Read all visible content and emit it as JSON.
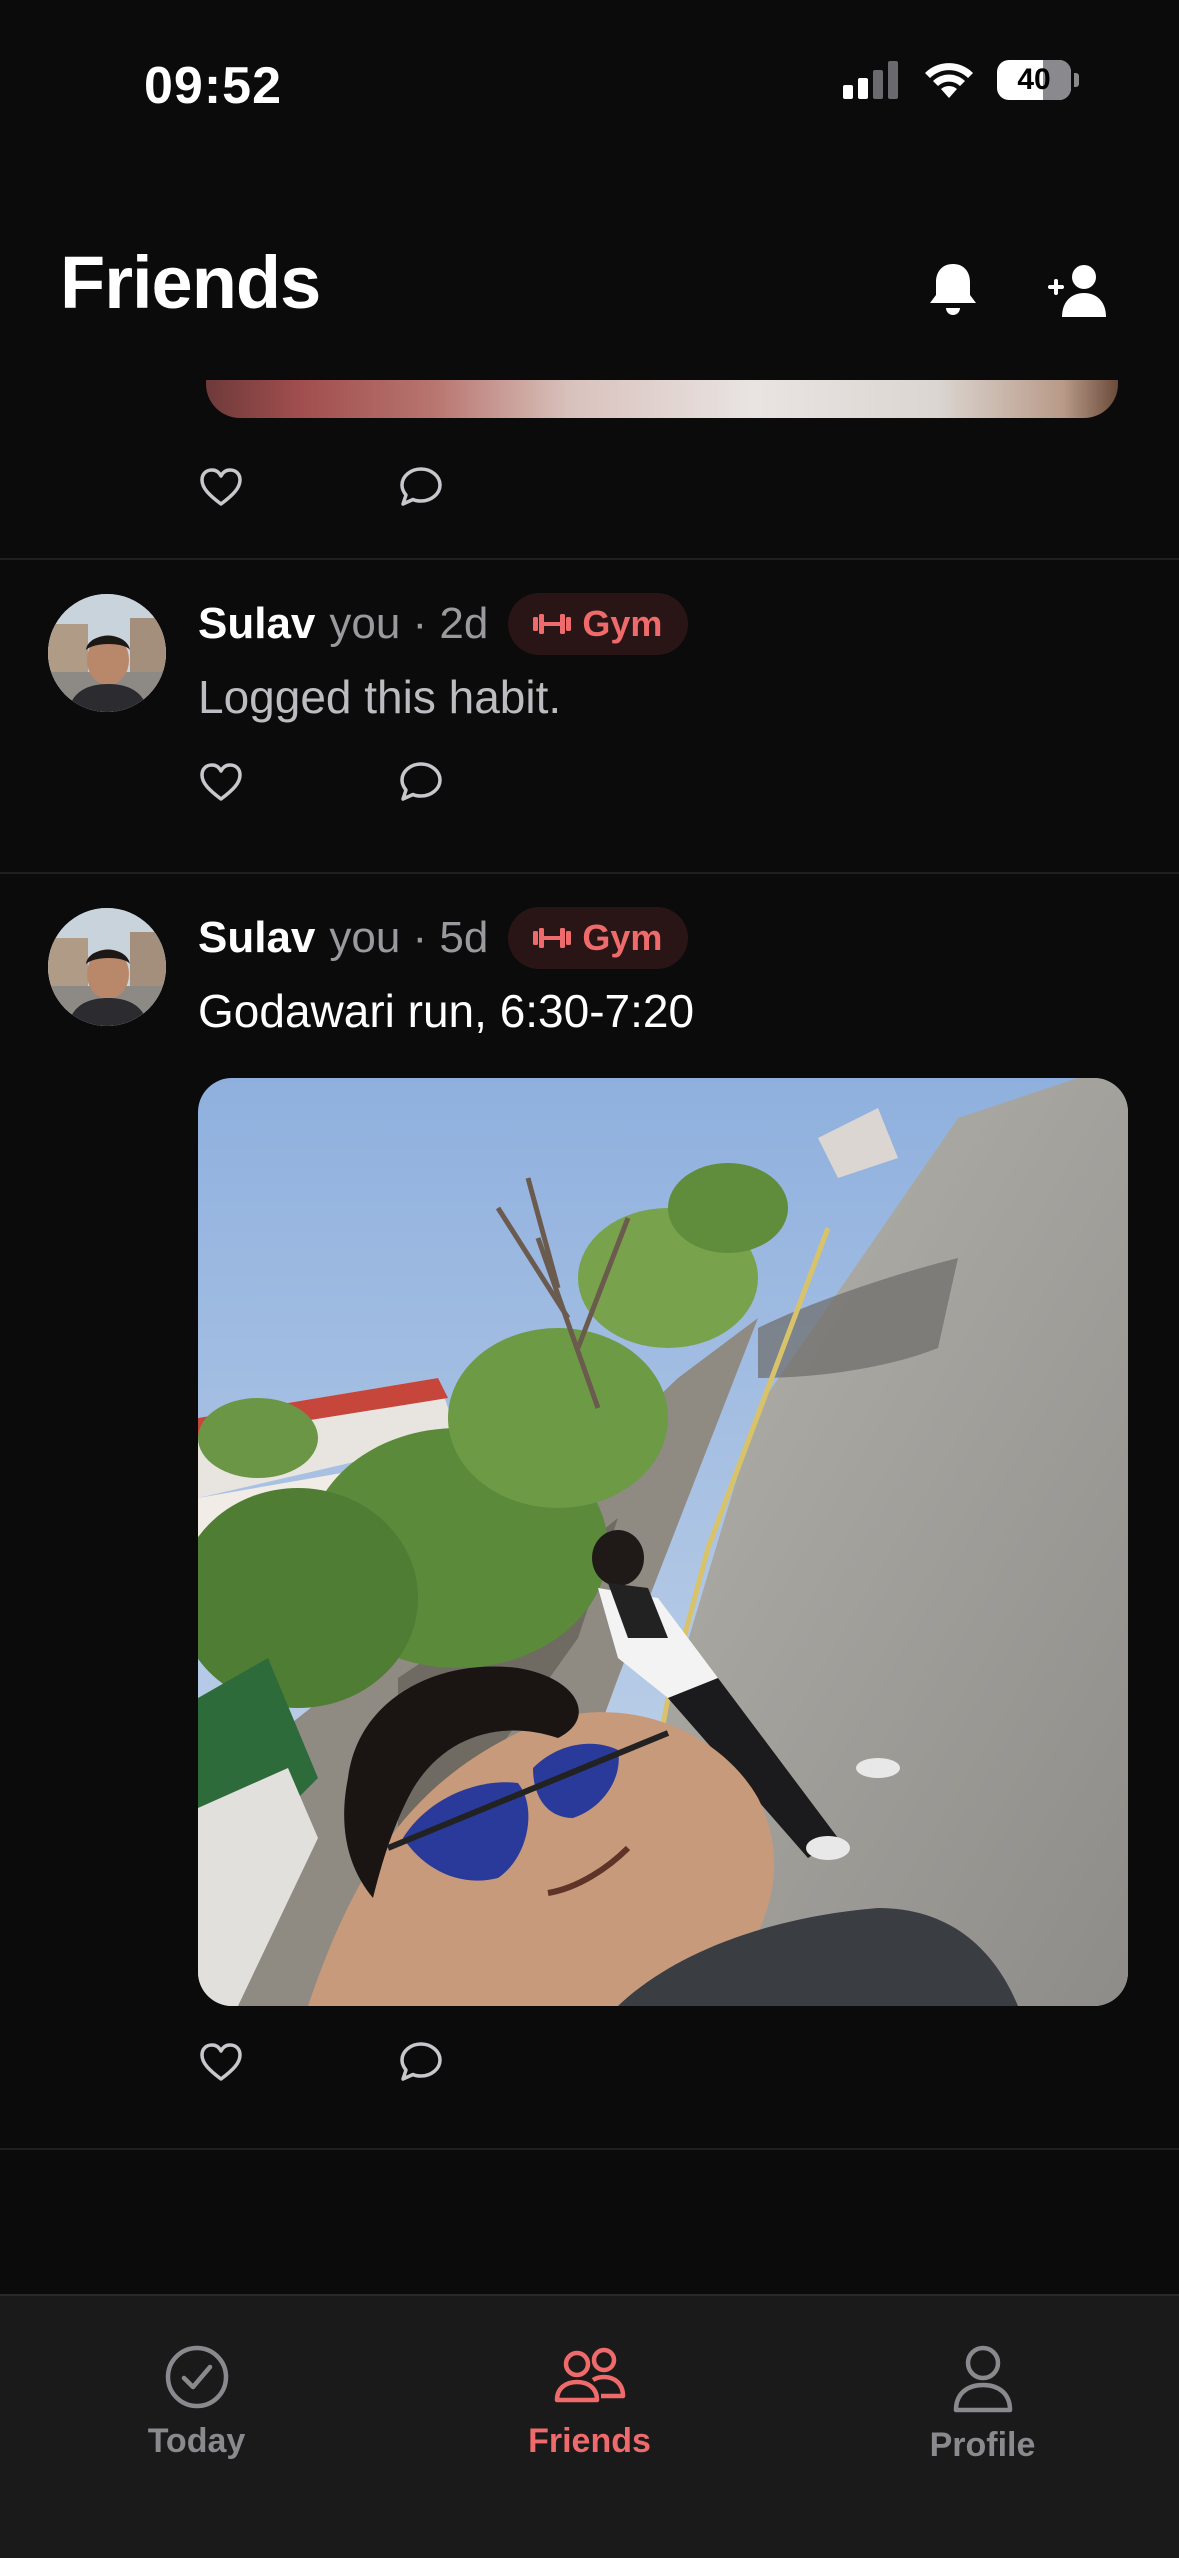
{
  "status_bar": {
    "time": "09:52",
    "battery": "40"
  },
  "header": {
    "title": "Friends",
    "icons": [
      "bell-icon",
      "add-friend-icon"
    ]
  },
  "feed": {
    "posts": [
      {
        "author": "Sulav",
        "meta": "you · 2d",
        "habit": "Gym",
        "text": "Logged this habit."
      },
      {
        "author": "Sulav",
        "meta": "you · 5d",
        "habit": "Gym",
        "text": "Godawari run, 6:30-7:20"
      }
    ],
    "action_icons": [
      "heart-icon",
      "comment-icon"
    ]
  },
  "tab_bar": {
    "tabs": [
      {
        "label": "Today",
        "icon": "check-circle-icon",
        "active": false
      },
      {
        "label": "Friends",
        "icon": "people-icon",
        "active": true
      },
      {
        "label": "Profile",
        "icon": "person-icon",
        "active": false
      }
    ],
    "active_color": "#ef6b6b",
    "inactive_color": "#8a8a8e"
  },
  "colors": {
    "background": "#0b0b0c",
    "accent": "#ef6b6b",
    "badge_bg": "#2a1516"
  }
}
